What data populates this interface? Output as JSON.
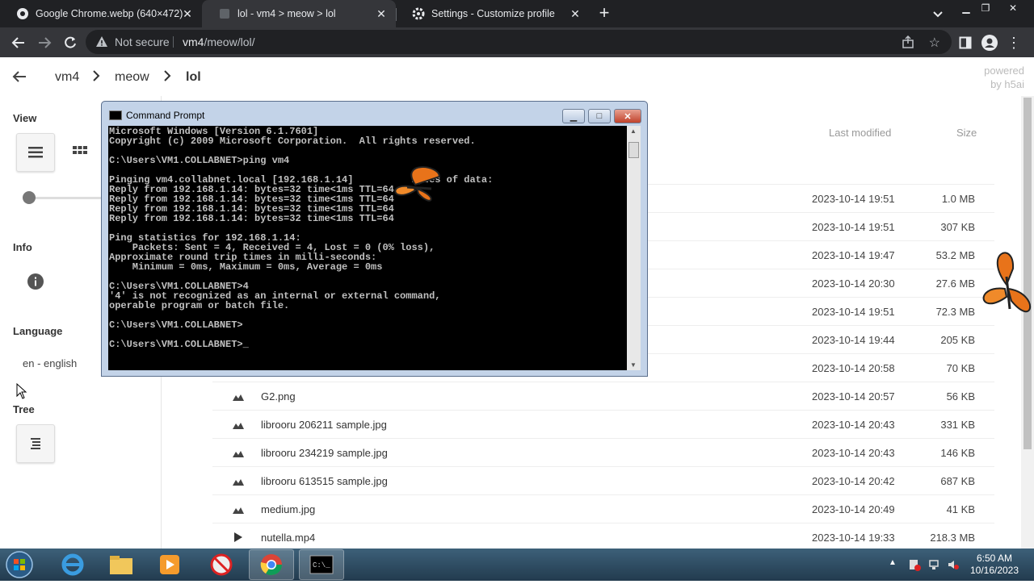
{
  "browser": {
    "tabs": [
      {
        "title": "Google Chrome.webp (640×472)",
        "favicon": "chrome-icon"
      },
      {
        "title": "lol - vm4 > meow > lol",
        "favicon": "page-icon"
      },
      {
        "title": "Settings - Customize profile",
        "favicon": "gear-icon"
      }
    ],
    "security_label": "Not secure",
    "url_host": "vm4",
    "url_path": "/meow/lol/"
  },
  "page": {
    "breadcrumb": [
      "vm4",
      "meow",
      "lol"
    ],
    "powered_line1": "powered",
    "powered_line2": "by h5ai",
    "sidebar": {
      "view_label": "View",
      "info_label": "Info",
      "language_label": "Language",
      "language_value": "en - english",
      "tree_label": "Tree"
    },
    "headers": {
      "modified": "Last modified",
      "size": "Size"
    },
    "files": [
      {
        "name": "",
        "date": "2023-10-14 19:51",
        "size": "1.0 MB",
        "icon": "image-icon"
      },
      {
        "name": "",
        "date": "2023-10-14 19:51",
        "size": "307 KB",
        "icon": "image-icon"
      },
      {
        "name": "",
        "date": "2023-10-14 19:47",
        "size": "53.2 MB",
        "icon": "image-icon"
      },
      {
        "name": "",
        "date": "2023-10-14 20:30",
        "size": "27.6 MB",
        "icon": "image-icon"
      },
      {
        "name": "",
        "date": "2023-10-14 19:51",
        "size": "72.3 MB",
        "icon": "image-icon"
      },
      {
        "name": "",
        "date": "2023-10-14 19:44",
        "size": "205 KB",
        "icon": "image-icon"
      },
      {
        "name": "",
        "date": "2023-10-14 20:58",
        "size": "70 KB",
        "icon": "image-icon"
      },
      {
        "name": "G2.png",
        "date": "2023-10-14 20:57",
        "size": "56 KB",
        "icon": "image-icon"
      },
      {
        "name": "librooru 206211 sample.jpg",
        "date": "2023-10-14 20:43",
        "size": "331 KB",
        "icon": "image-icon"
      },
      {
        "name": "librooru 234219 sample.jpg",
        "date": "2023-10-14 20:43",
        "size": "146 KB",
        "icon": "image-icon"
      },
      {
        "name": "librooru 613515 sample.jpg",
        "date": "2023-10-14 20:42",
        "size": "687 KB",
        "icon": "image-icon"
      },
      {
        "name": "medium.jpg",
        "date": "2023-10-14 20:49",
        "size": "41 KB",
        "icon": "image-icon"
      },
      {
        "name": "nutella.mp4",
        "date": "2023-10-14 19:33",
        "size": "218.3 MB",
        "icon": "play-icon"
      }
    ]
  },
  "cmd": {
    "title": "Command Prompt",
    "lines": [
      "Microsoft Windows [Version 6.1.7601]",
      "Copyright (c) 2009 Microsoft Corporation.  All rights reserved.",
      "",
      "C:\\Users\\VM1.COLLABNET>ping vm4",
      "",
      "Pinging vm4.collabnet.local [192.168.1.14]          bytes of data:",
      "Reply from 192.168.1.14: bytes=32 time<1ms TTL=64",
      "Reply from 192.168.1.14: bytes=32 time<1ms TTL=64",
      "Reply from 192.168.1.14: bytes=32 time<1ms TTL=64",
      "Reply from 192.168.1.14: bytes=32 time<1ms TTL=64",
      "",
      "Ping statistics for 192.168.1.14:",
      "    Packets: Sent = 4, Received = 4, Lost = 0 (0% loss),",
      "Approximate round trip times in milli-seconds:",
      "    Minimum = 0ms, Maximum = 0ms, Average = 0ms",
      "",
      "C:\\Users\\VM1.COLLABNET>4",
      "'4' is not recognized as an internal or external command,",
      "operable program or batch file.",
      "",
      "C:\\Users\\VM1.COLLABNET>",
      "",
      "C:\\Users\\VM1.COLLABNET>_"
    ]
  },
  "taskbar": {
    "time": "6:50 AM",
    "date": "10/16/2023"
  },
  "colors": {
    "chrome_dark": "#202124",
    "chrome_toolbar": "#35363a",
    "butterfly": "#e8731a"
  }
}
